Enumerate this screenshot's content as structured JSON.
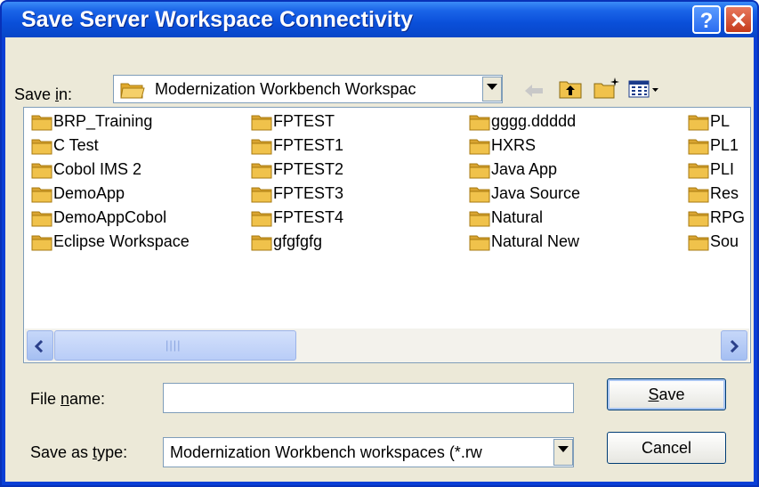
{
  "window": {
    "title": "Save Server Workspace Connectivity",
    "help_symbol": "?",
    "close_symbol": "✕"
  },
  "save_in": {
    "label_prefix": "Save ",
    "label_accel": "i",
    "label_suffix": "n:",
    "value": "Modernization Workbench Workspac"
  },
  "folders": [
    [
      "BRP_Training",
      "C Test",
      "Cobol IMS 2",
      "DemoApp",
      "DemoAppCobol",
      "Eclipse Workspace"
    ],
    [
      "FPTEST",
      "FPTEST1",
      "FPTEST2",
      "FPTEST3",
      "FPTEST4",
      "gfgfgfg"
    ],
    [
      "gggg.ddddd",
      "HXRS",
      "Java App",
      "Java Source",
      "Natural",
      "Natural New"
    ],
    [
      "PL",
      "PL1",
      "PLI",
      "Res",
      "RPG",
      "Sou"
    ]
  ],
  "scrollbar": {
    "grip": "||||"
  },
  "file_name": {
    "label_prefix": "File ",
    "label_accel": "n",
    "label_suffix": "ame:",
    "value": ""
  },
  "save_as_type": {
    "label_prefix": "Save as ",
    "label_accel": "t",
    "label_suffix": "ype:",
    "value": "Modernization Workbench workspaces (*.rw"
  },
  "buttons": {
    "save_accel": "S",
    "save_rest": "ave",
    "cancel": "Cancel"
  },
  "colors": {
    "title_bar": "#0a4fd9",
    "dialog_face": "#ece9d8",
    "close_button": "#c53a1b",
    "folder": "#f0c24b"
  }
}
